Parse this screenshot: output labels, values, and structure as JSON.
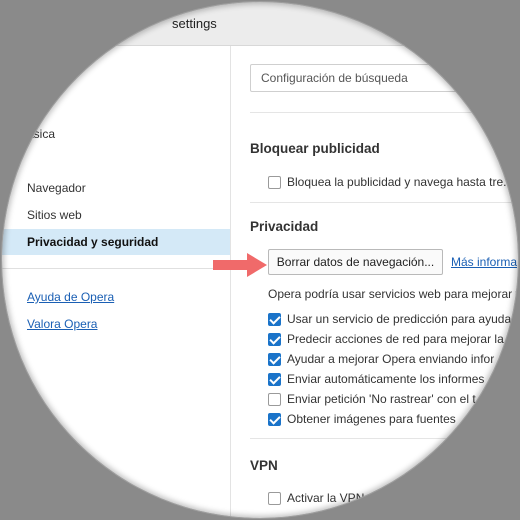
{
  "window": {
    "title": "settings"
  },
  "sidebar": {
    "items": [
      {
        "label": "ásica"
      },
      {
        "label": "Navegador"
      },
      {
        "label": "Sitios web"
      },
      {
        "label": "Privacidad y seguridad"
      }
    ],
    "links": [
      {
        "label": "Ayuda de Opera"
      },
      {
        "label": "Valora Opera"
      }
    ]
  },
  "main": {
    "search_value": "Configuración de búsqueda",
    "adblock": {
      "heading": "Bloquear publicidad",
      "option": {
        "label": "Bloquea la publicidad y navega hasta tre...",
        "checked": false
      }
    },
    "privacy": {
      "heading": "Privacidad",
      "clear_button": "Borrar datos de navegación...",
      "more_link": "Más informa",
      "description": "Opera podría usar servicios web para mejorar t",
      "options": [
        {
          "label": "Usar un servicio de predicción para ayuda",
          "checked": true
        },
        {
          "label": "Predecir acciones de red para mejorar la",
          "checked": true
        },
        {
          "label": "Ayudar a mejorar Opera enviando infor",
          "checked": true
        },
        {
          "label": "Enviar automáticamente los informes",
          "checked": true
        },
        {
          "label": "Enviar petición 'No rastrear' con el t",
          "checked": false
        },
        {
          "label": "Obtener imágenes para fuentes",
          "checked": true
        }
      ]
    },
    "vpn": {
      "heading": "VPN",
      "option": {
        "label": "Activar la VPN",
        "checked": false
      }
    }
  },
  "colors": {
    "accent": "#1a73c9",
    "active_item_bg": "#d4e9f7",
    "link": "#1a5fb4",
    "pointer_arrow": "#f06a6a"
  },
  "icons": {
    "pointer": "right-arrow-icon"
  }
}
